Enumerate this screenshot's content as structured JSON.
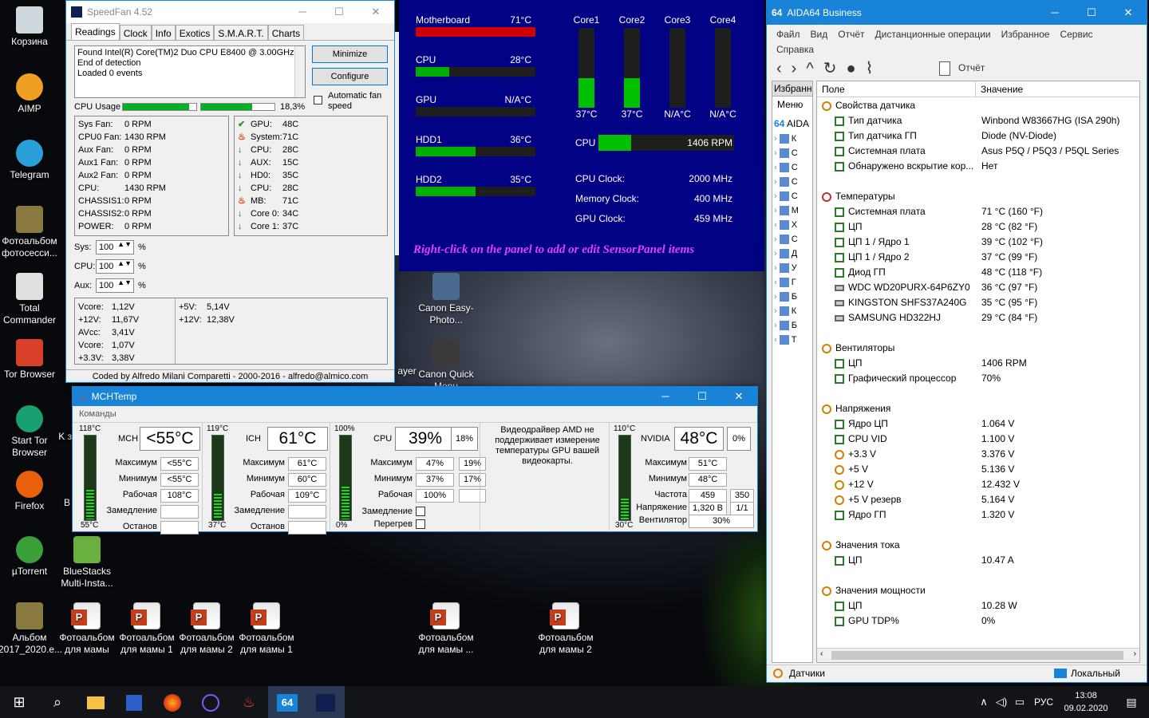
{
  "desktop": {
    "icons": [
      {
        "label": "Корзина",
        "icon": "recycle-bin-icon"
      },
      {
        "label": "AIMP",
        "icon": "aimp-icon"
      },
      {
        "label": "Telegram",
        "icon": "telegram-icon"
      },
      {
        "label": "Фотоальбом фотосесси...",
        "icon": "photo-album-icon"
      },
      {
        "label": "Total Commander",
        "icon": "total-commander-icon"
      },
      {
        "label": "Tor Browser",
        "icon": "tor-browser-icon"
      },
      {
        "label": "Start Tor Browser",
        "icon": "start-tor-icon"
      },
      {
        "label": "Firefox",
        "icon": "firefox-icon"
      },
      {
        "label": "µTorrent",
        "icon": "utorrent-icon"
      },
      {
        "label": "BlueStacks Multi-Insta...",
        "icon": "bluestacks-icon"
      },
      {
        "label": "Альбом 2017_2020.e...",
        "icon": "album-icon"
      },
      {
        "label": "Фотоальбом для мамы",
        "icon": "ppt-icon"
      },
      {
        "label": "Фотоальбом для мамы 1",
        "icon": "ppt-icon"
      },
      {
        "label": "Фотоальбом для мамы 2",
        "icon": "ppt-icon"
      },
      {
        "label": "Фотоальбом для мамы 1",
        "icon": "ppt-icon"
      },
      {
        "label": "Фотоальбом для мамы ...",
        "icon": "ppt-icon"
      },
      {
        "label": "Фотоальбом для мамы 2",
        "icon": "ppt-icon"
      },
      {
        "label": "Canon Easy-Photo...",
        "icon": "canon-icon"
      },
      {
        "label": "Canon Quick Menu",
        "icon": "canon-quick-icon"
      }
    ],
    "partial": [
      "ayer",
      "K за",
      "B"
    ]
  },
  "speedfan": {
    "title": "SpeedFan 4.52",
    "tabs": [
      "Readings",
      "Clock",
      "Info",
      "Exotics",
      "S.M.A.R.T.",
      "Charts"
    ],
    "log": [
      "Found Intel(R) Core(TM)2 Duo CPU E8400 @ 3.00GHz",
      "End of detection",
      "Loaded 0 events"
    ],
    "minimize": "Minimize",
    "configure": "Configure",
    "auto_fan": "Automatic fan speed",
    "cpu_usage_label": "CPU Usage",
    "cpu_usage": "18,3%",
    "cpu_usage_fill": [
      0.9,
      0.7
    ],
    "fans": [
      [
        "Sys Fan:",
        "0 RPM"
      ],
      [
        "CPU0 Fan:",
        "1430 RPM"
      ],
      [
        "Aux Fan:",
        "0 RPM"
      ],
      [
        "Aux1 Fan:",
        "0 RPM"
      ],
      [
        "Aux2 Fan:",
        "0 RPM"
      ],
      [
        "CPU:",
        "1430 RPM"
      ],
      [
        "CHASSIS1:",
        "0 RPM"
      ],
      [
        "CHASSIS2:",
        "0 RPM"
      ],
      [
        "POWER:",
        "0 RPM"
      ]
    ],
    "temps": [
      [
        "GPU:",
        "48C",
        "check"
      ],
      [
        "System:",
        "71C",
        "fire"
      ],
      [
        "CPU:",
        "28C",
        "down"
      ],
      [
        "AUX:",
        "15C",
        "down"
      ],
      [
        "HD0:",
        "35C",
        "down"
      ],
      [
        "CPU:",
        "28C",
        "down"
      ],
      [
        "MB:",
        "71C",
        "fire"
      ],
      [
        "Core 0:",
        "34C",
        "down"
      ],
      [
        "Core 1:",
        "37C",
        "down"
      ]
    ],
    "speeds": [
      [
        "Sys:",
        "100"
      ],
      [
        "CPU:",
        "100"
      ],
      [
        "Aux:",
        "100"
      ]
    ],
    "pct": "%",
    "volts_l": [
      [
        "Vcore:",
        "1,12V"
      ],
      [
        "+12V:",
        "11,67V"
      ],
      [
        "AVcc:",
        "3,41V"
      ],
      [
        "Vcore:",
        "1,07V"
      ],
      [
        "+3.3V:",
        "3,38V"
      ]
    ],
    "volts_r": [
      [
        "+5V:",
        "5,14V"
      ],
      [
        "+12V:",
        "12,38V"
      ]
    ],
    "footer": "Coded by Alfredo Milani Comparetti - 2000-2016 - alfredo@almico.com"
  },
  "sensorpanel": {
    "hbars": [
      {
        "label": "Motherboard",
        "value": "71°C",
        "fill": 1.0,
        "color": "#d00000"
      },
      {
        "label": "CPU",
        "value": "28°C",
        "fill": 0.28,
        "color": "#00b000"
      },
      {
        "label": "GPU",
        "value": "N/A°C",
        "fill": 0,
        "color": "#00b000"
      },
      {
        "label": "HDD1",
        "value": "36°C",
        "fill": 0.5,
        "color": "#00b000"
      },
      {
        "label": "HDD2",
        "value": "35°C",
        "fill": 0.5,
        "color": "#00b000"
      }
    ],
    "cores": [
      {
        "label": "Core1",
        "value": "37°C",
        "fill": 0.37
      },
      {
        "label": "Core2",
        "value": "37°C",
        "fill": 0.37
      },
      {
        "label": "Core3",
        "value": "N/A°C",
        "fill": 0
      },
      {
        "label": "Core4",
        "value": "N/A°C",
        "fill": 0
      }
    ],
    "cpu_fan": {
      "label": "CPU",
      "value": "1406 RPM",
      "fill": 0.24
    },
    "clocks": [
      [
        "CPU Clock:",
        "2000 MHz"
      ],
      [
        "Memory Clock:",
        "400 MHz"
      ],
      [
        "GPU Clock:",
        "459 MHz"
      ]
    ],
    "hint": "Right-click on the panel to add or edit SensorPanel items"
  },
  "mchtemp": {
    "title": "MCHTemp",
    "menu": "Команды",
    "mch": {
      "max_scale": "118°C",
      "min_scale": "55°C",
      "name": "MCH",
      "value": "<55°C",
      "fill": 0.35,
      "rows": [
        [
          "Максимум",
          "<55°C"
        ],
        [
          "Минимум",
          "<55°C"
        ],
        [
          "Рабочая",
          "108°C"
        ],
        [
          "Замедление",
          ""
        ],
        [
          "Останов",
          ""
        ]
      ]
    },
    "ich": {
      "max_scale": "119°C",
      "min_scale": "37°C",
      "name": "ICH",
      "value": "61°C",
      "fill": 0.3,
      "rows": [
        [
          "Максимум",
          "61°C"
        ],
        [
          "Минимум",
          "60°C"
        ],
        [
          "Рабочая",
          "109°C"
        ],
        [
          "Замедление",
          ""
        ],
        [
          "Останов",
          ""
        ]
      ]
    },
    "cpu": {
      "max_scale": "100%",
      "min_scale": "0%",
      "name": "CPU",
      "value": "39%",
      "core2": "18%",
      "fill": 0.39,
      "rows": [
        [
          "Максимум",
          "47%",
          "19%"
        ],
        [
          "Минимум",
          "37%",
          "17%"
        ],
        [
          "Рабочая",
          "100%",
          ""
        ]
      ],
      "throttle": "Замедление",
      "overheat": "Перегрев"
    },
    "amd_note": "Видеодрайвер AMD не поддерживает измерение температуры GPU вашей видеокарты.",
    "nvidia": {
      "max_scale": "110°C",
      "min_scale": "30°C",
      "name": "NVIDIA",
      "value": "48°C",
      "load": "0%",
      "fill": 0.25,
      "rows": [
        [
          "Максимум",
          "51°C"
        ],
        [
          "Минимум",
          "48°C"
        ]
      ],
      "freq_label": "Частота",
      "freq": [
        "459",
        "350"
      ],
      "volt_label": "Напряжение",
      "volt": [
        "1,320 В",
        "1/1"
      ],
      "fan_label": "Вентилятор",
      "fan": "30%"
    }
  },
  "aida": {
    "title": "AIDA64 Business",
    "menu": [
      "Файл",
      "Вид",
      "Отчёт",
      "Дистанционные операции",
      "Избранное",
      "Сервис",
      "Справка"
    ],
    "report": "Отчёт",
    "side_tabs": [
      "Избранное",
      "Меню"
    ],
    "side_root": "AIDA",
    "cols": [
      "Поле",
      "Значение"
    ],
    "rows": [
      {
        "t": "h",
        "icon": "sensor",
        "f": "Свойства датчика"
      },
      {
        "t": "r",
        "icon": "chip",
        "f": "Тип датчика",
        "v": "Winbond W83667HG  (ISA 290h)"
      },
      {
        "t": "r",
        "icon": "chip",
        "f": "Тип датчика ГП",
        "v": "Diode  (NV-Diode)"
      },
      {
        "t": "r",
        "icon": "board",
        "f": "Системная плата",
        "v": "Asus P5Q / P5Q3 / P5QL Series"
      },
      {
        "t": "r",
        "icon": "shield",
        "f": "Обнаружено вскрытие кор...",
        "v": "Нет"
      },
      {
        "t": "g"
      },
      {
        "t": "h",
        "icon": "thermo",
        "f": "Температуры"
      },
      {
        "t": "r",
        "icon": "board",
        "f": "Системная плата",
        "v": "71 °C  (160 °F)"
      },
      {
        "t": "r",
        "icon": "cpu",
        "f": "ЦП",
        "v": "28 °C  (82 °F)"
      },
      {
        "t": "r",
        "icon": "cpu",
        "f": "ЦП 1 / Ядро 1",
        "v": "39 °C  (102 °F)"
      },
      {
        "t": "r",
        "icon": "cpu",
        "f": "ЦП 1 / Ядро 2",
        "v": "37 °C  (99 °F)"
      },
      {
        "t": "r",
        "icon": "gpu",
        "f": "Диод ГП",
        "v": "48 °C  (118 °F)"
      },
      {
        "t": "r",
        "icon": "hdd",
        "f": "WDC WD20PURX-64P6ZY0",
        "v": "36 °C  (97 °F)"
      },
      {
        "t": "r",
        "icon": "hdd",
        "f": "KINGSTON SHFS37A240G",
        "v": "35 °C  (95 °F)"
      },
      {
        "t": "r",
        "icon": "hdd",
        "f": "SAMSUNG HD322HJ",
        "v": "29 °C  (84 °F)"
      },
      {
        "t": "g"
      },
      {
        "t": "h",
        "icon": "fan",
        "f": "Вентиляторы"
      },
      {
        "t": "r",
        "icon": "cpu",
        "f": "ЦП",
        "v": "1406 RPM"
      },
      {
        "t": "r",
        "icon": "gpu",
        "f": "Графический процессор",
        "v": "70%"
      },
      {
        "t": "g"
      },
      {
        "t": "h",
        "icon": "volt",
        "f": "Напряжения"
      },
      {
        "t": "r",
        "icon": "cpu",
        "f": "Ядро ЦП",
        "v": "1.064 V"
      },
      {
        "t": "r",
        "icon": "cpu",
        "f": "CPU VID",
        "v": "1.100 V"
      },
      {
        "t": "r",
        "icon": "volt",
        "f": "+3.3 V",
        "v": "3.376 V"
      },
      {
        "t": "r",
        "icon": "volt",
        "f": "+5 V",
        "v": "5.136 V"
      },
      {
        "t": "r",
        "icon": "volt",
        "f": "+12 V",
        "v": "12.432 V"
      },
      {
        "t": "r",
        "icon": "volt",
        "f": "+5 V резерв",
        "v": "5.164 V"
      },
      {
        "t": "r",
        "icon": "gpu",
        "f": "Ядро ГП",
        "v": "1.320 V"
      },
      {
        "t": "g"
      },
      {
        "t": "h",
        "icon": "volt",
        "f": "Значения тока"
      },
      {
        "t": "r",
        "icon": "cpu",
        "f": "ЦП",
        "v": "10.47 A"
      },
      {
        "t": "g"
      },
      {
        "t": "h",
        "icon": "volt",
        "f": "Значения мощности"
      },
      {
        "t": "r",
        "icon": "cpu",
        "f": "ЦП",
        "v": "10.28 W"
      },
      {
        "t": "r",
        "icon": "gpu",
        "f": "GPU TDP%",
        "v": "0%"
      }
    ],
    "tree_letters": [
      "К",
      "С",
      "С",
      "С",
      "С",
      "М",
      "Х",
      "С",
      "Д",
      "У",
      "Г",
      "Б",
      "К",
      "Б",
      "Т"
    ],
    "status_left": "Датчики",
    "status_right": "Локальный"
  },
  "taskbar": {
    "lang": "РУС",
    "time": "13:08",
    "date": "09.02.2020"
  }
}
